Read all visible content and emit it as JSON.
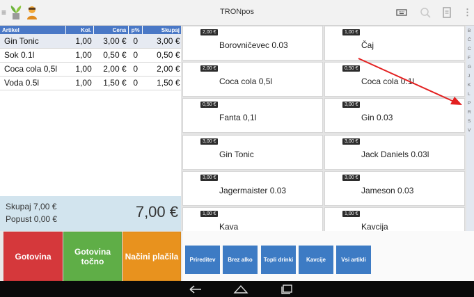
{
  "app": {
    "title": "TRONpos",
    "menu_glyph": "≡"
  },
  "order": {
    "columns": [
      "Artikel",
      "Kol.",
      "Cena",
      "p%",
      "Skupaj"
    ],
    "rows": [
      {
        "name": "Gin Tonic",
        "qty": "1,00",
        "price": "3,00 €",
        "pct": "0",
        "total": "3,00 €"
      },
      {
        "name": "Sok 0.1l",
        "qty": "1,00",
        "price": "0,50 €",
        "pct": "0",
        "total": "0,50 €"
      },
      {
        "name": "Coca cola 0,5l",
        "qty": "1,00",
        "price": "2,00 €",
        "pct": "0",
        "total": "2,00 €"
      },
      {
        "name": "Voda 0.5l",
        "qty": "1,00",
        "price": "1,50 €",
        "pct": "0",
        "total": "1,50 €"
      }
    ]
  },
  "totals": {
    "skupaj": "Skupaj 7,00 €",
    "popust": "Popust 0,00 €",
    "big": "7,00 €"
  },
  "payment": {
    "cash": "Gotovina",
    "exact": "Gotovina točno",
    "methods": "Načini plačila"
  },
  "products": [
    {
      "price": "2,00 €",
      "name": "Borovničevec 0.03"
    },
    {
      "price": "1,00 €",
      "name": "Čaj"
    },
    {
      "price": "2,00 €",
      "name": "Coca cola 0,5l"
    },
    {
      "price": "0,50 €",
      "name": "Coca cola 0.1l"
    },
    {
      "price": "0,50 €",
      "name": "Fanta 0,1l"
    },
    {
      "price": "3,00 €",
      "name": "Gin 0.03"
    },
    {
      "price": "3,00 €",
      "name": "Gin Tonic"
    },
    {
      "price": "3,00 €",
      "name": "Jack Daniels 0.03l"
    },
    {
      "price": "3,00 €",
      "name": "Jagermaister 0.03"
    },
    {
      "price": "3,00 €",
      "name": "Jameson 0.03"
    },
    {
      "price": "1,00 €",
      "name": "Kava"
    },
    {
      "price": "1,00 €",
      "name": "Kavcija"
    }
  ],
  "alphabet": [
    "B",
    "Č",
    "C",
    "F",
    "G",
    "J",
    "K",
    "L",
    "P",
    "R",
    "S",
    "V"
  ],
  "categories": [
    "Prireditev",
    "Brez alko",
    "Topli drinki",
    "Kavcije",
    "Vsi artikli"
  ],
  "colors": {
    "header_blue": "#4a78c6",
    "category_blue": "#3d7bc4",
    "cash_red": "#d5383b",
    "exact_green": "#5fae47",
    "methods_orange": "#e8921e",
    "annotation_arrow": "#e32020"
  },
  "icons": {
    "plant": "plant-icon",
    "user": "user-icon",
    "keyboard": "keyboard-icon",
    "search": "search-icon",
    "document": "document-icon",
    "overflow": "overflow-menu-icon",
    "back": "back-icon",
    "home": "home-icon",
    "recents": "recents-icon"
  }
}
